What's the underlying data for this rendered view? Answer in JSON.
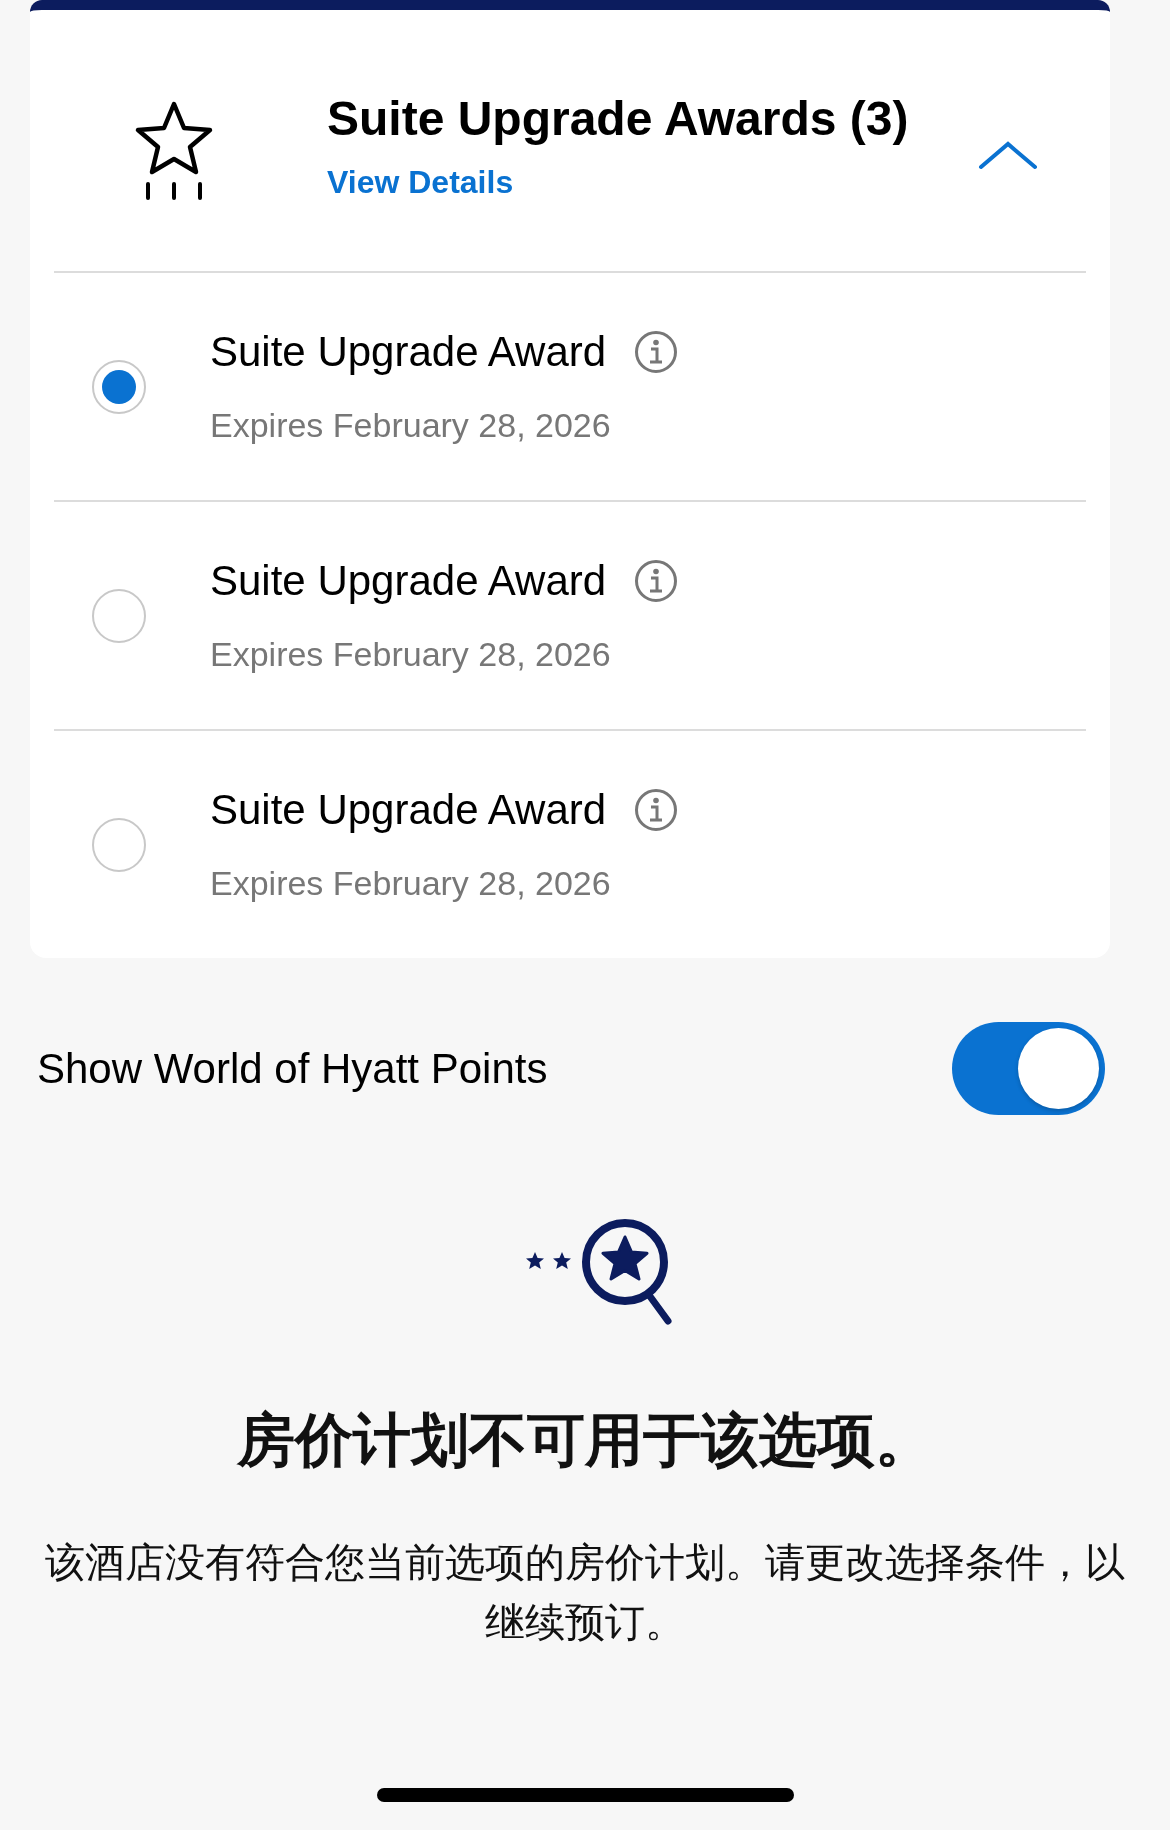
{
  "awards_card": {
    "title": "Suite Upgrade Awards (3)",
    "link": "View Details",
    "expanded": true,
    "awards": [
      {
        "name": "Suite Upgrade Award",
        "expires": "Expires February 28, 2026",
        "selected": true
      },
      {
        "name": "Suite Upgrade Award",
        "expires": "Expires February 28, 2026",
        "selected": false
      },
      {
        "name": "Suite Upgrade Award",
        "expires": "Expires February 28, 2026",
        "selected": false
      }
    ]
  },
  "points_toggle": {
    "label": "Show World of Hyatt Points",
    "on": true
  },
  "empty_state": {
    "heading": "房价计划不可用于该选项。",
    "message": "该酒店没有符合您当前选项的房价计划。请更改选择条件，以继续预订。"
  }
}
